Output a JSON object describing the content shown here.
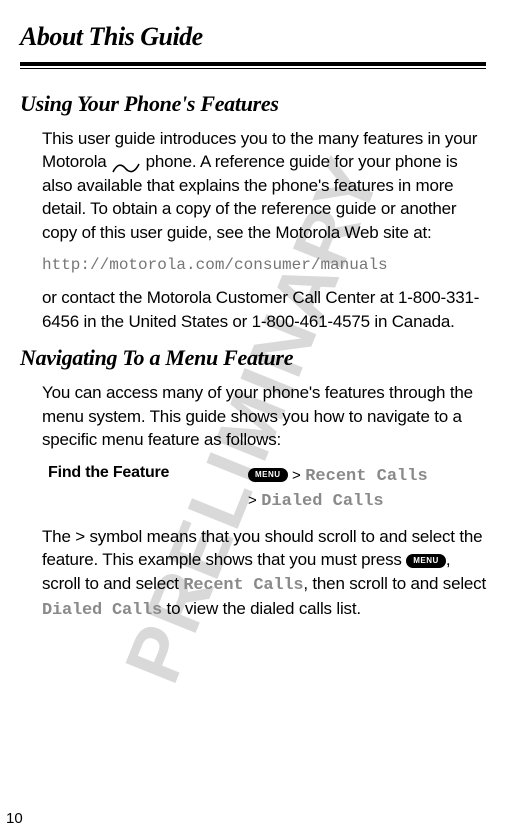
{
  "watermark": "PRELIMINARY",
  "chapterTitle": "About This Guide",
  "section1": {
    "title": "Using Your Phone's Features",
    "para1a": "This user guide introduces you to the many features in your Motorola ",
    "para1b": " phone. A reference guide for your phone is also available that explains the phone's features in more detail. To obtain a copy of the reference guide or another copy of this user guide, see the Motorola Web site at:",
    "url": "http://motorola.com/consumer/manuals",
    "para2": "or contact the Motorola Customer Call Center at 1-800-331-6456 in the United States or 1-800-461-4575 in Canada."
  },
  "section2": {
    "title": "Navigating To a Menu Feature",
    "para1": "You can access many of your phone's features through the menu system. This guide shows you how to navigate to a specific menu feature as follows:",
    "findLabel": "Find the Feature",
    "menuKeyLabel": "MENU",
    "gt": ">",
    "menuItem1": "Recent Calls",
    "menuItem2": "Dialed Calls",
    "para2a": "The > symbol means that you should scroll to and select the feature. This example shows that you must press ",
    "para2b": ", scroll to and select ",
    "para2c": ", then scroll to and select ",
    "para2d": " to view the dialed calls list."
  },
  "pageNumber": "10"
}
